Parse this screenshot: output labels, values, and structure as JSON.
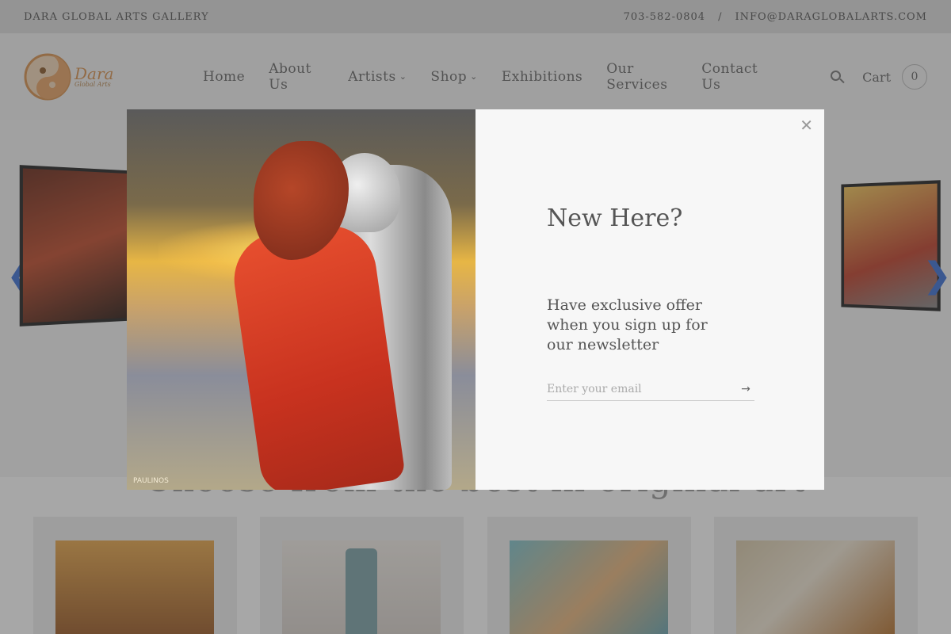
{
  "topbar": {
    "gallery_name": "DARA GLOBAL ARTS GALLERY",
    "phone": "703-582-0804",
    "separator": "/",
    "email": "INFO@DARAGLOBALARTS.COM"
  },
  "header": {
    "logo_text": "Dara",
    "logo_subtext": "Global Arts",
    "nav": [
      {
        "label": "Home"
      },
      {
        "label": "About Us"
      },
      {
        "label": "Artists",
        "has_dropdown": true
      },
      {
        "label": "Shop",
        "has_dropdown": true
      },
      {
        "label": "Exhibitions"
      },
      {
        "label": "Our Services"
      },
      {
        "label": "Contact Us"
      }
    ],
    "cart_label": "Cart",
    "cart_count": "0"
  },
  "hero": {
    "prev_icon": "chevron-left-icon",
    "next_icon": "chevron-right-icon"
  },
  "section": {
    "title": "Choose from the best in original art"
  },
  "modal": {
    "title": "New Here?",
    "text": "Have exclusive offer when you sign up for our newsletter",
    "email_placeholder": "Enter your email",
    "close_icon": "close-icon",
    "submit_icon": "arrow-right-icon",
    "signature": "PAULINOS"
  },
  "colors": {
    "overlay": "#3c3c3c",
    "arrow_accent": "#3b6fd6"
  }
}
